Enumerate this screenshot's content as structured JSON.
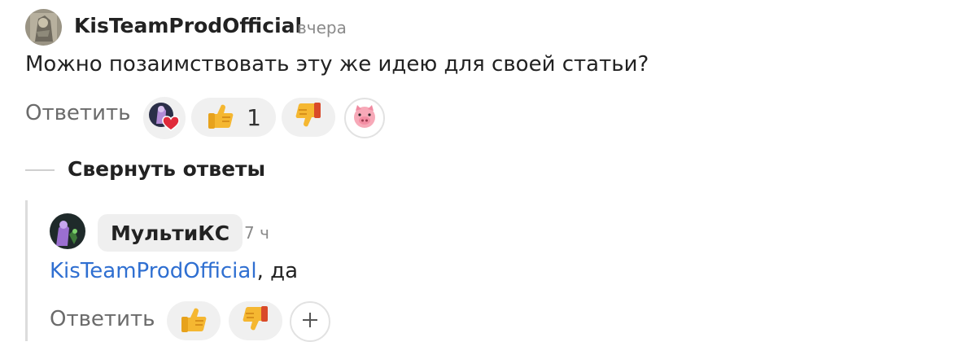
{
  "comment": {
    "author": "KisTeamProdOfficial",
    "time": "вчера",
    "text": "Можно позаимствовать эту же идею для своей статьи?",
    "reply_label": "Ответить",
    "like_count": "1",
    "reactions": [
      "heart-reaction-icon",
      "thumbs-up-icon",
      "thumbs-down-icon",
      "pig-icon"
    ]
  },
  "collapse": {
    "label": "Свернуть ответы"
  },
  "reply": {
    "author": "МультиКС",
    "time": "7 ч",
    "mention": "KisTeamProdOfficial",
    "text": ", да",
    "reply_label": "Ответить",
    "reactions": [
      "thumbs-up-icon",
      "thumbs-down-icon",
      "plus-icon"
    ]
  },
  "colors": {
    "mention": "#2f6fd1",
    "pill_bg": "#f0f0f0",
    "muted": "#6b6b6b"
  }
}
